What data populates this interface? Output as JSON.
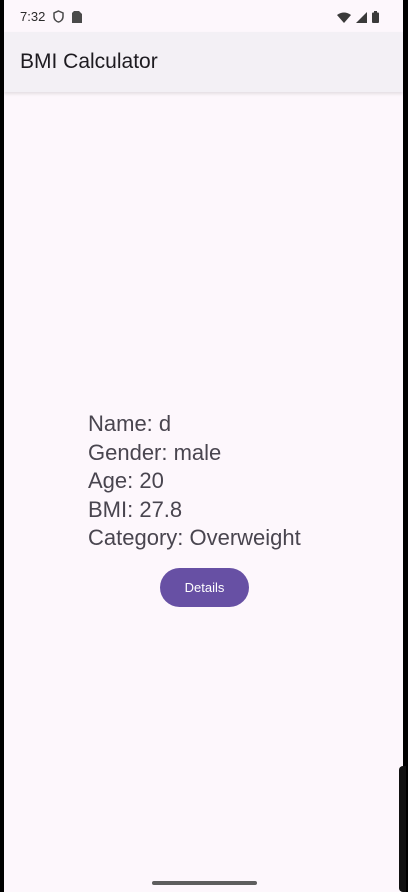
{
  "status_bar": {
    "time": "7:32",
    "left_icons": [
      "shield-icon",
      "sim-card-icon"
    ],
    "right_icons": [
      "wifi-icon",
      "signal-icon",
      "battery-icon"
    ]
  },
  "app_bar": {
    "title": "BMI Calculator"
  },
  "result": {
    "name_line": "Name: d",
    "gender_line": "Gender: male",
    "age_line": "Age: 20",
    "bmi_line": "BMI: 27.8",
    "category_line": "Category: Overweight"
  },
  "actions": {
    "details_label": "Details"
  },
  "colors": {
    "background": "#fdf7fc",
    "app_bar": "#f3f0f5",
    "primary": "#6750a4",
    "text": "#49454f"
  }
}
